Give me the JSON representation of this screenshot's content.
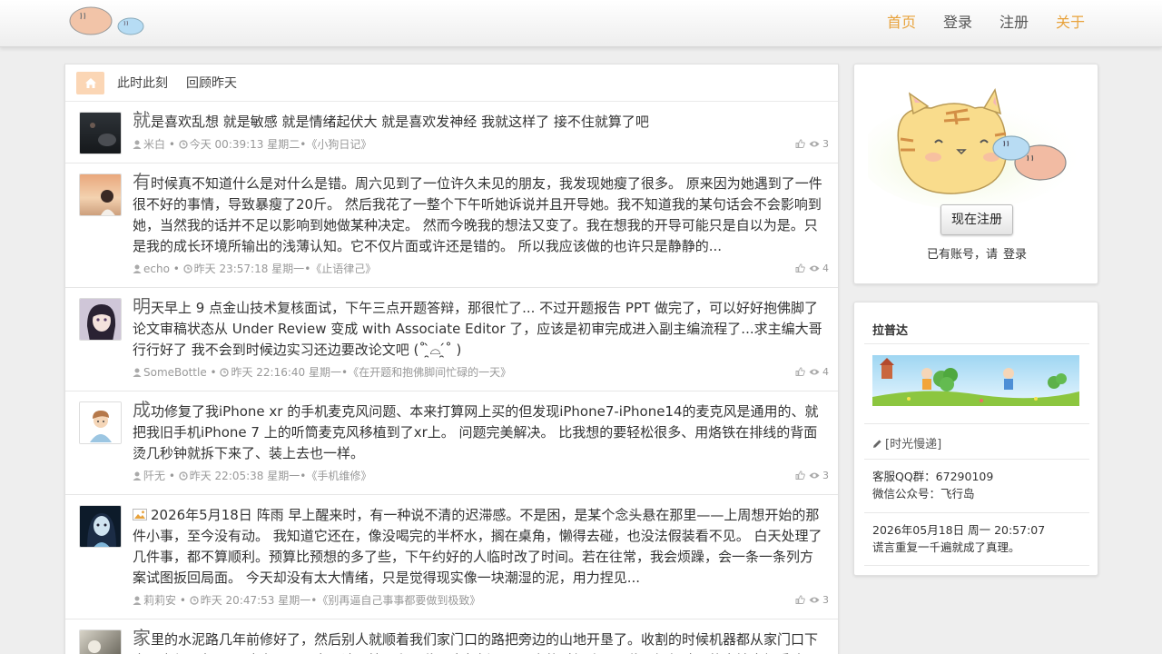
{
  "nav": [
    {
      "label": "首页",
      "accent": true
    },
    {
      "label": "登录",
      "accent": false
    },
    {
      "label": "注册",
      "accent": false
    },
    {
      "label": "关于",
      "accent": true
    }
  ],
  "tabs": {
    "home_icon": "home-icon",
    "now": "此时此刻",
    "yesterday": "回顾昨天"
  },
  "posts": [
    {
      "first": "就",
      "text": "是喜欢乱想 就是敏感 就是情绪起伏大 就是喜欢发神经 我就这样了 接不住就算了吧",
      "author": "米白",
      "time": "今天 00:39:13 星期二",
      "topic": "《小狗日记》",
      "count": "3",
      "has_image": false
    },
    {
      "first": "有",
      "text": "时候真不知道什么是对什么是错。周六见到了一位许久未见的朋友，我发现她瘦了很多。 原来因为她遇到了一件很不好的事情，导致暴瘦了20斤。 然后我花了一整个下午听她诉说并且开导她。我不知道我的某句话会不会影响到她，当然我的话并不足以影响到她做某种决定。 然而今晚我的想法又变了。我在想我的开导可能只是自以为是。只是我的成长环境所输出的浅薄认知。它不仅片面或许还是错的。 所以我应该做的也许只是静静的...",
      "author": "echo",
      "time": "昨天 23:57:18 星期一",
      "topic": "《止语律己》",
      "count": "4",
      "has_image": false
    },
    {
      "first": "明",
      "text": "天早上 9 点金山技术复核面试，下午三点开题答辩，那很忙了... 不过开题报告 PPT 做完了，可以好好抱佛脚了 论文审稿状态从 Under Review 变成 with Associate Editor 了，应该是初审完成进入副主编流程了...求主编大哥行行好了 我不会到时候边实习还边要改论文吧 (˚ ̯̀⌓ ̯́˚ )",
      "author": "SomeBottle",
      "time": "昨天 22:16:40 星期一",
      "topic": "《在开题和抱佛脚间忙碌的一天》",
      "count": "4",
      "has_image": false
    },
    {
      "first": "成",
      "text": "功修复了我iPhone xr 的手机麦克风问题、本来打算网上买的但发现iPhone7-iPhone14的麦克风是通用的、就把我旧手机iPhone 7 上的听筒麦克风移植到了xr上。 问题完美解决。 比我想的要轻松很多、用烙铁在排线的背面烫几秒钟就拆下来了、装上去也一样。",
      "author": "阡无",
      "time": "昨天 22:05:38 星期一",
      "topic": "《手机维修》",
      "count": "3",
      "has_image": false
    },
    {
      "first": "",
      "text": "2026年5月18日 阵雨 早上醒来时，有一种说不清的迟滞感。不是困，是某个念头悬在那里——上周想开始的那件小事，至今没有动。 我知道它还在，像没喝完的半杯水，搁在桌角，懒得去碰，也没法假装看不见。 白天处理了几件事，都不算顺利。预算比预想的多了些，下午约好的人临时改了时间。若在往常，我会烦躁，会一条一条列方案试图扳回局面。 今天却没有太大情绪，只是觉得现实像一块潮湿的泥，用力捏见...",
      "author": "莉莉安",
      "time": "昨天 20:47:53 星期一",
      "topic": "《别再逼自己事事都要做到极致》",
      "count": "3",
      "has_image": true
    },
    {
      "first": "家",
      "text": "里的水泥路几年前修好了，然后别人就顺着我们家门口的路把旁边的山地开垦了。收割的时候机器都从家门口下去，方便了邻里。 这次五一回去，请工娘子和王爷子去帮拟玩，回来的时候聊天王爷子提起队里的土地应规重建",
      "author": "",
      "time": "",
      "topic": "",
      "count": "",
      "has_image": false
    }
  ],
  "sidebar": {
    "register_label": "现在注册",
    "have_account": "已有账号，请",
    "login_label": "登录",
    "section_title": "拉普达",
    "tag": "[时光慢递]",
    "qq": "客服QQ群：67290109",
    "wechat": "微信公众号：飞行岛",
    "datetime": "2026年05月18日 周一 20:57:07",
    "quote": "谎言重复一千遍就成了真理。"
  },
  "colors": {
    "accent": "#e8a33d",
    "home_bg": "#fbd6b5",
    "meta": "#999999"
  }
}
